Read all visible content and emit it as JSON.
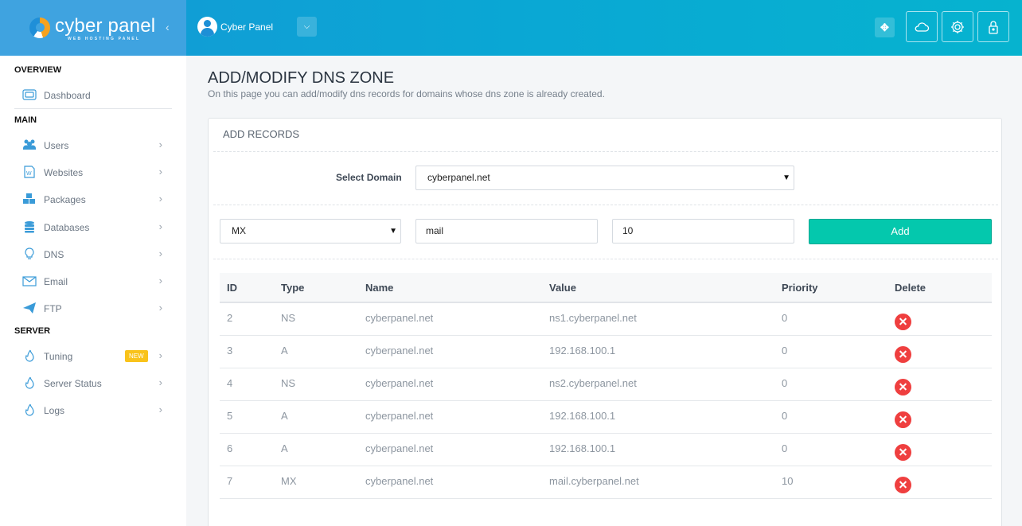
{
  "header": {
    "logo_text": "cyber panel",
    "logo_subtext": "WEB HOSTING PANEL",
    "user_name": "Cyber Panel",
    "icons": [
      "collapse-arrow-icon",
      "user-avatar-icon",
      "chevron-down-icon",
      "fullscreen-icon",
      "cloud-icon",
      "gear-icon",
      "lock-icon"
    ]
  },
  "sidebar": {
    "sections": [
      {
        "title": "OVERVIEW",
        "items": [
          {
            "label": "Dashboard",
            "icon": "dashboard-icon"
          }
        ]
      },
      {
        "title": "MAIN",
        "items": [
          {
            "label": "Users",
            "icon": "users-icon"
          },
          {
            "label": "Websites",
            "icon": "websites-icon"
          },
          {
            "label": "Packages",
            "icon": "packages-icon"
          },
          {
            "label": "Databases",
            "icon": "database-icon"
          },
          {
            "label": "DNS",
            "icon": "lightbulb-icon"
          },
          {
            "label": "Email",
            "icon": "email-icon"
          },
          {
            "label": "FTP",
            "icon": "paper-plane-icon"
          }
        ]
      },
      {
        "title": "SERVER",
        "items": [
          {
            "label": "Tuning",
            "icon": "flame-icon",
            "badge": "NEW"
          },
          {
            "label": "Server Status",
            "icon": "flame-icon"
          },
          {
            "label": "Logs",
            "icon": "flame-icon"
          }
        ]
      }
    ]
  },
  "page": {
    "title": "ADD/MODIFY DNS ZONE",
    "description": "On this page you can add/modify dns records for domains whose dns zone is already created."
  },
  "panel": {
    "heading": "ADD RECORDS",
    "select_domain_label": "Select Domain",
    "domain_value": "cyberpanel.net",
    "record_type": "MX",
    "name_value": "mail",
    "priority_value": "10",
    "add_label": "Add"
  },
  "table": {
    "columns": [
      "ID",
      "Type",
      "Name",
      "Value",
      "Priority",
      "Delete"
    ],
    "rows": [
      {
        "id": "2",
        "type": "NS",
        "name": "cyberpanel.net",
        "value": "ns1.cyberpanel.net",
        "priority": "0"
      },
      {
        "id": "3",
        "type": "A",
        "name": "cyberpanel.net",
        "value": "192.168.100.1",
        "priority": "0"
      },
      {
        "id": "4",
        "type": "NS",
        "name": "cyberpanel.net",
        "value": "ns2.cyberpanel.net",
        "priority": "0"
      },
      {
        "id": "5",
        "type": "A",
        "name": "cyberpanel.net",
        "value": "192.168.100.1",
        "priority": "0"
      },
      {
        "id": "6",
        "type": "A",
        "name": "cyberpanel.net",
        "value": "192.168.100.1",
        "priority": "0"
      },
      {
        "id": "7",
        "type": "MX",
        "name": "cyberpanel.net",
        "value": "mail.cyberpanel.net",
        "priority": "10"
      }
    ]
  },
  "colors": {
    "header_gradient_start": "#1499d6",
    "header_gradient_end": "#06b3cf",
    "logo_bg": "#3fa3e0",
    "add_button": "#04c8ad",
    "delete_icon": "#ef3f3f",
    "badge_new": "#f9c31b",
    "sidebar_icon": "#3a9bd8"
  }
}
